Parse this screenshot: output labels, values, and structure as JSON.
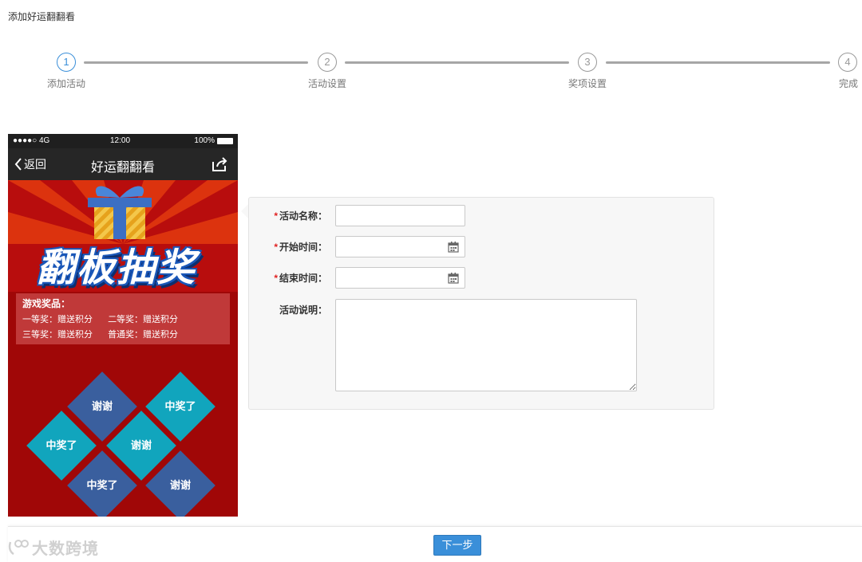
{
  "page": {
    "title": "添加好运翻翻看"
  },
  "stepper": {
    "steps": [
      {
        "number": "1",
        "label": "添加活动"
      },
      {
        "number": "2",
        "label": "活动设置"
      },
      {
        "number": "3",
        "label": "奖项设置"
      },
      {
        "number": "4",
        "label": "完成"
      }
    ],
    "active_step": 1
  },
  "phone": {
    "status": {
      "signal": "●●●●○ 4G",
      "time": "12:00",
      "battery": "100%"
    },
    "nav": {
      "back_label": "返回",
      "title": "好运翻翻看"
    },
    "banner_title": "翻板抽奖",
    "prizes": {
      "title": "游戏奖品：",
      "rows": [
        [
          "一等奖：赠送积分",
          "二等奖：赠送积分"
        ],
        [
          "三等奖：赠送积分",
          "普通奖：赠送积分"
        ]
      ]
    },
    "tiles": [
      "谢谢",
      "中奖了",
      "中奖了",
      "谢谢",
      "中奖了",
      "谢谢"
    ]
  },
  "form": {
    "required_mark": "*",
    "name": {
      "label": "活动名称：",
      "value": "",
      "placeholder": ""
    },
    "start_time": {
      "label": "开始时间：",
      "value": "",
      "placeholder": ""
    },
    "end_time": {
      "label": "结束时间：",
      "value": "",
      "placeholder": ""
    },
    "description": {
      "label": "活动说明：",
      "value": "",
      "placeholder": ""
    }
  },
  "footer": {
    "next_label": "下一步"
  },
  "watermark": "大数跨境",
  "colors": {
    "accent": "#3a8fd9",
    "required": "#e02020",
    "phone_bg": "#a00707",
    "tile_blue": "#3a5f9e",
    "tile_teal": "#11a5bd"
  }
}
